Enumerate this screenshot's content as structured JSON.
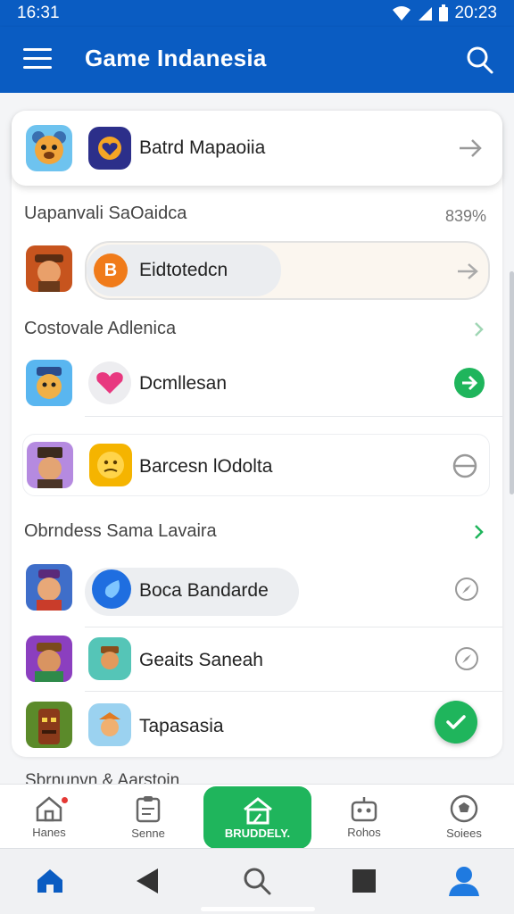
{
  "status_bar": {
    "time": "16:31",
    "clock_right": "20:23"
  },
  "app_bar": {
    "title": "Game Indanesia"
  },
  "featured": {
    "label": "Batrd Mapaoiia"
  },
  "section1": {
    "title": "Uapanvali SaOaidca",
    "value": "839%"
  },
  "items": [
    {
      "label": "Eidtotedcn",
      "action": "arrow-right"
    },
    {
      "label": "Dcmllesan",
      "action": "arrow-right-circle"
    },
    {
      "label": "Barcesn lOdolta",
      "action": "slash-circle"
    },
    {
      "label": "Boca Bandarde",
      "action": "compass"
    },
    {
      "label": "Geaits Saneah",
      "action": "compass"
    },
    {
      "label": "Tapasasia",
      "action": "check"
    }
  ],
  "section2": {
    "title": "Costovale Adlenica"
  },
  "section3": {
    "title": "Obrndess Sama Lavaira"
  },
  "peek_text": "Sbrnunvn & Aarstoin",
  "bottom_tabs": [
    {
      "label": "Hanes",
      "icon": "home-icon"
    },
    {
      "label": "Senne",
      "icon": "clipboard-icon"
    },
    {
      "label": "BRUDDELY.",
      "icon": "store-icon"
    },
    {
      "label": "Rohos",
      "icon": "robot-icon"
    },
    {
      "label": "Soiees",
      "icon": "football-icon"
    }
  ],
  "colors": {
    "primary": "#0a5cc2",
    "accent": "#1fb55c"
  }
}
